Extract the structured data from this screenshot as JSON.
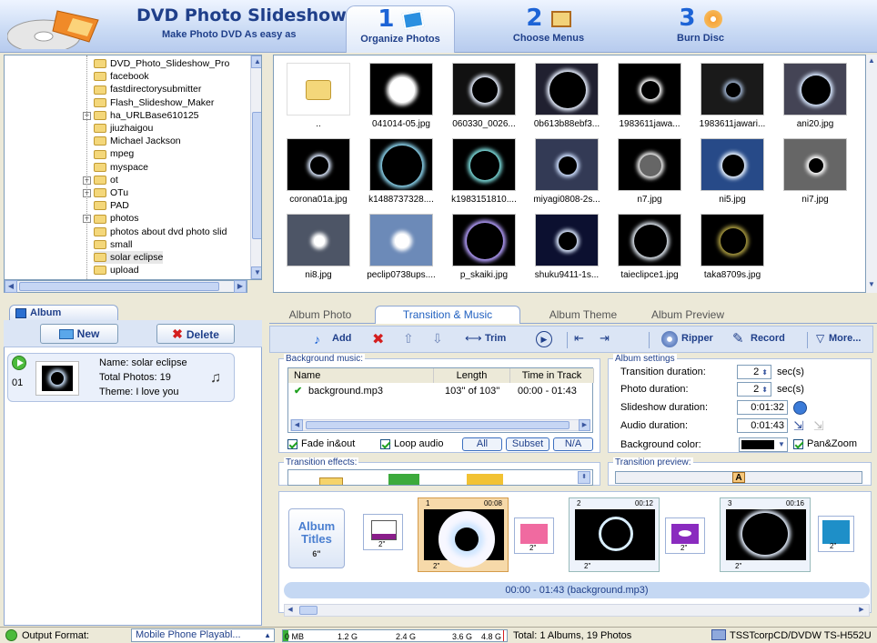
{
  "header": {
    "title": "DVD Photo Slideshow",
    "subtitle": "Make Photo DVD As easy as",
    "steps": [
      {
        "number": "1",
        "label": "Organize Photos"
      },
      {
        "number": "2",
        "label": "Choose Menus"
      },
      {
        "number": "3",
        "label": "Burn Disc"
      }
    ]
  },
  "tree": {
    "items": [
      "DVD_Photo_Slideshow_Pro",
      "facebook",
      "fastdirectorysubmitter",
      "Flash_Slideshow_Maker",
      "ha_URLBase610125",
      "jiuzhaigou",
      "Michael Jackson",
      "mpeg",
      "myspace",
      "ot",
      "OTu",
      "PAD",
      "photos",
      "photos about dvd  photo slid",
      "small",
      "solar eclipse",
      "upload"
    ],
    "selected": "solar eclipse"
  },
  "photos": [
    "..",
    "041014-05.jpg",
    "060330_0026...",
    "0b613b88ebf3...",
    "1983611jawa...",
    "1983611jawari...",
    "ani20.jpg",
    "corona01a.jpg",
    "k1488737328....",
    "k1983151810....",
    "miyagi0808-2s...",
    "n7.jpg",
    "ni5.jpg",
    "ni7.jpg",
    "ni8.jpg",
    "peclip0738ups....",
    "p_skaiki.jpg",
    "shuku9411-1s...",
    "taieclipce1.jpg",
    "taka8709s.jpg"
  ],
  "album": {
    "tab": "Album",
    "new_label": "New",
    "delete_label": "Delete",
    "entry": {
      "index": "01",
      "name": "Name: solar eclipse",
      "total": "Total Photos: 19",
      "theme": "Theme: I love you"
    }
  },
  "tabs": [
    "Album Photo",
    "Transition & Music",
    "Album Theme",
    "Album Preview"
  ],
  "toolbar": {
    "add": "Add",
    "trim": "Trim",
    "ripper": "Ripper",
    "record": "Record",
    "more": "More..."
  },
  "music": {
    "group_label": "Background music:",
    "headers": [
      "Name",
      "Length",
      "Time in Track"
    ],
    "row": {
      "name": "background.mp3",
      "length": "103'' of 103''",
      "time": "00:00 - 01:43"
    },
    "fade": "Fade in&out",
    "loop": "Loop audio",
    "btn_all": "All",
    "btn_subset": "Subset",
    "btn_na": "N/A"
  },
  "settings": {
    "group_label": "Album settings",
    "transition_label": "Transition duration:",
    "transition_value": "2",
    "photo_label": "Photo duration:",
    "photo_value": "2",
    "unit": "sec(s)",
    "slideshow_label": "Slideshow duration:",
    "slideshow_value": "0:01:32",
    "audio_label": "Audio duration:",
    "audio_value": "0:01:43",
    "bg_label": "Background color:",
    "panzoom": "Pan&Zoom"
  },
  "transition_effects_label": "Transition effects:",
  "transition_preview_label": "Transition preview:",
  "transition_preview_letter": "A",
  "timeline": {
    "album_titles": "Album Titles",
    "title_dur": "6\"",
    "slides": [
      {
        "num": "1",
        "time": "00:08"
      },
      {
        "num": "2",
        "time": "00:12"
      },
      {
        "num": "3",
        "time": "00:16"
      }
    ],
    "dur": "2\"",
    "music_bar": "00:00 - 01:43 (background.mp3)"
  },
  "status": {
    "output_label": "Output Format:",
    "output_value": "Mobile Phone Playabl...",
    "ruler": [
      "0 MB",
      "1.2 G",
      "2.4 G",
      "3.6 G",
      "4.8 G"
    ],
    "total": "Total: 1 Albums, 19 Photos",
    "drive": "TSSTcorpCD/DVDW TS-H552U"
  },
  "colors": {
    "accent": "#1f3f8a",
    "header_bg": "#c9daf4",
    "music_bar": "#c5d8f3"
  }
}
